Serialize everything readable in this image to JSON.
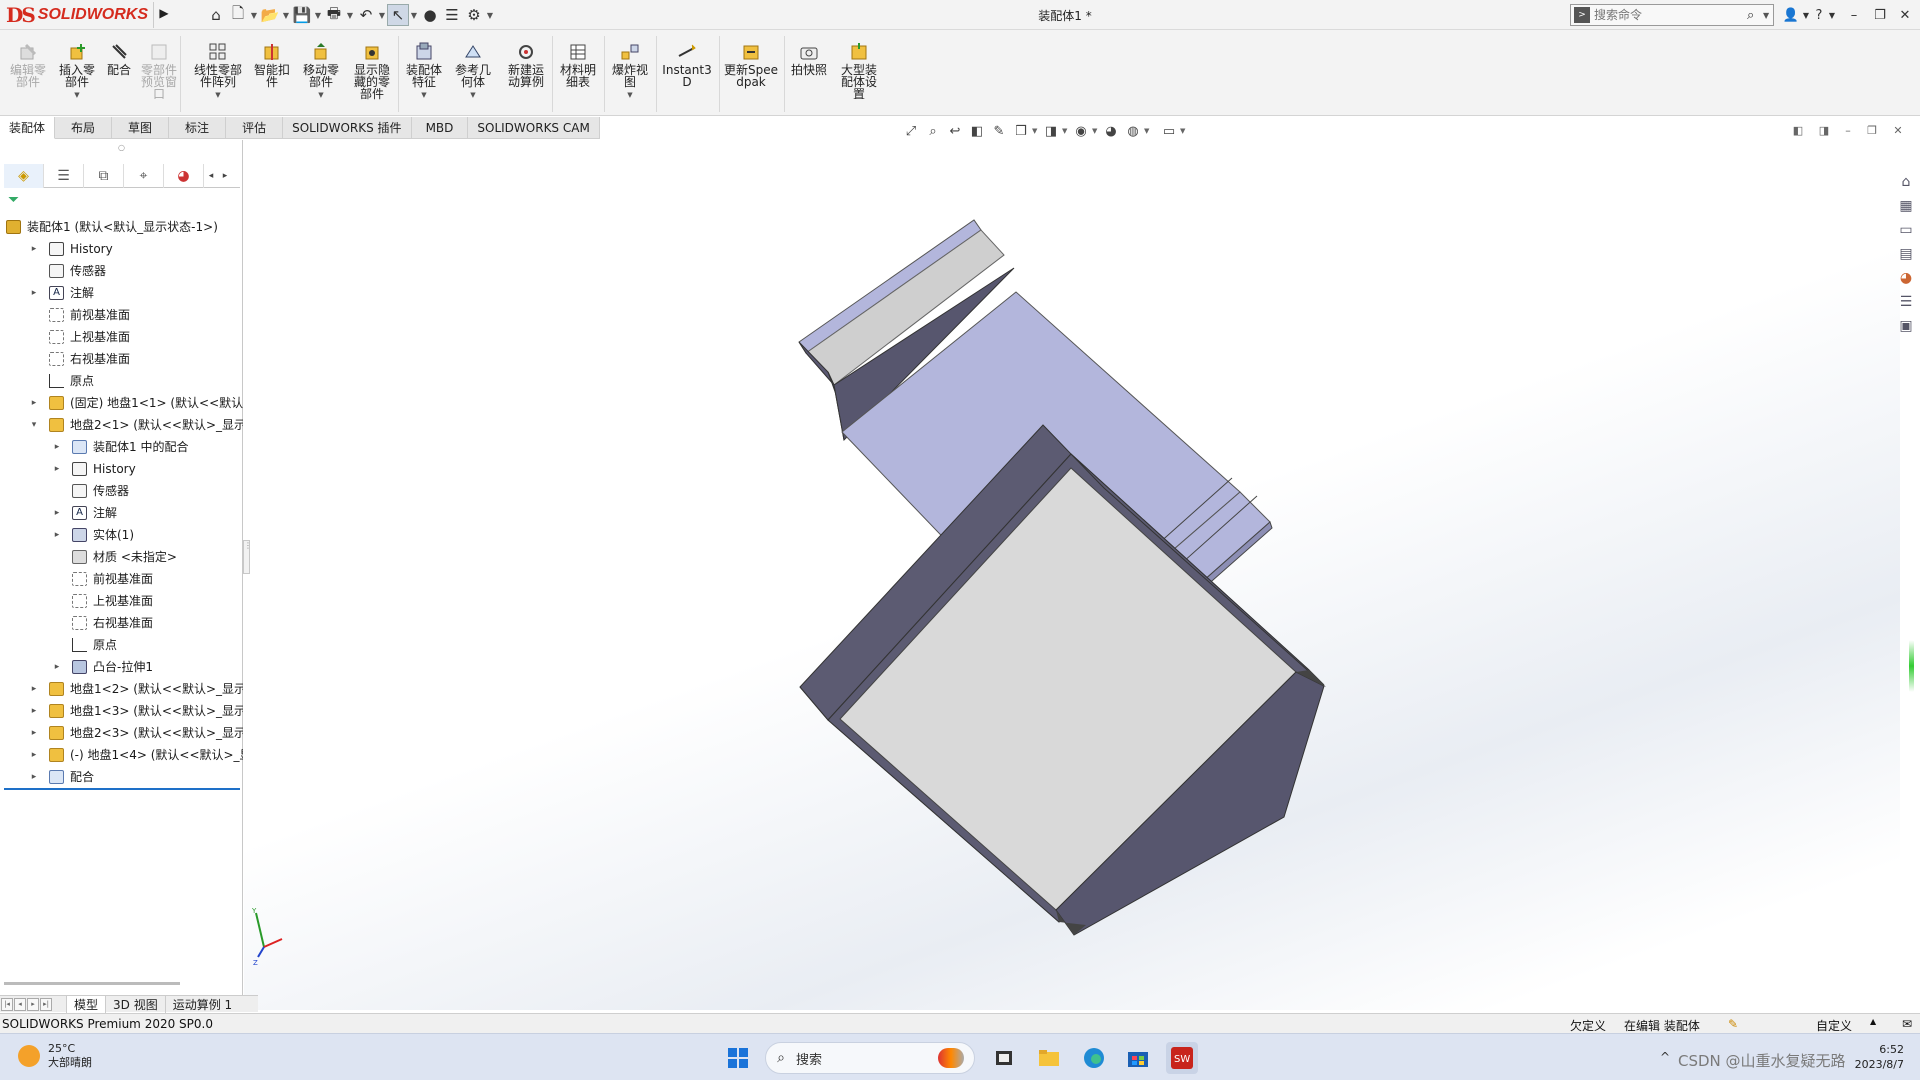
{
  "window": {
    "logo_mark": "DS",
    "logo_text": "SOLIDWORKS",
    "title": "装配体1 *",
    "search_placeholder": "搜索命令"
  },
  "quick_access": [
    "home-icon",
    "new-icon",
    "open-icon",
    "save-icon",
    "print-icon",
    "undo-icon",
    "select-icon",
    "rebuild-icon",
    "file-properties-icon",
    "options-icon"
  ],
  "toolbar": [
    {
      "label": "编辑零部件",
      "disabled": true,
      "icon": "edit-component-icon"
    },
    {
      "label": "插入零部件",
      "disabled": false,
      "icon": "insert-component-icon",
      "dropdown": true
    },
    {
      "label": "配合",
      "disabled": false,
      "icon": "mate-icon"
    },
    {
      "label": "零部件预览窗口",
      "disabled": true,
      "icon": "component-preview-icon"
    },
    {
      "label": "线性零部件阵列",
      "disabled": false,
      "icon": "linear-pattern-icon",
      "dropdown": true
    },
    {
      "label": "智能扣件",
      "disabled": false,
      "icon": "smart-fasteners-icon"
    },
    {
      "label": "移动零部件",
      "disabled": false,
      "icon": "move-component-icon",
      "dropdown": true
    },
    {
      "label": "显示隐藏的零部件",
      "disabled": false,
      "icon": "show-hidden-icon"
    },
    {
      "label": "装配体特征",
      "disabled": false,
      "icon": "assembly-features-icon",
      "dropdown": true
    },
    {
      "label": "参考几何体",
      "disabled": false,
      "icon": "reference-geometry-icon",
      "dropdown": true
    },
    {
      "label": "新建运动算例",
      "disabled": false,
      "icon": "new-motion-study-icon"
    },
    {
      "label": "材料明细表",
      "disabled": false,
      "icon": "bom-icon"
    },
    {
      "label": "爆炸视图",
      "disabled": false,
      "icon": "exploded-view-icon",
      "dropdown": true
    },
    {
      "label": "Instant3D",
      "disabled": false,
      "icon": "instant3d-icon"
    },
    {
      "label": "更新Speedpak",
      "disabled": false,
      "icon": "speedpak-icon"
    },
    {
      "label": "拍快照",
      "disabled": false,
      "icon": "snapshot-icon"
    },
    {
      "label": "大型装配体设置",
      "disabled": false,
      "icon": "large-assembly-icon"
    }
  ],
  "tabs": [
    "装配体",
    "布局",
    "草图",
    "标注",
    "评估",
    "SOLIDWORKS 插件",
    "MBD",
    "SOLIDWORKS CAM"
  ],
  "active_tab": "装配体",
  "tree": [
    {
      "label": "装配体1  (默认<默认_显示状态-1>)",
      "level": 0,
      "expander": "",
      "icon": "asm"
    },
    {
      "label": "History",
      "level": 1,
      "expander": "▸",
      "icon": "hist"
    },
    {
      "label": "传感器",
      "level": 1,
      "expander": "",
      "icon": "sens"
    },
    {
      "label": "注解",
      "level": 1,
      "expander": "▸",
      "icon": "ann"
    },
    {
      "label": "前视基准面",
      "level": 1,
      "expander": "",
      "icon": "plane"
    },
    {
      "label": "上视基准面",
      "level": 1,
      "expander": "",
      "icon": "plane"
    },
    {
      "label": "右视基准面",
      "level": 1,
      "expander": "",
      "icon": "plane"
    },
    {
      "label": "原点",
      "level": 1,
      "expander": "",
      "icon": "orig"
    },
    {
      "label": "(固定) 地盘1<1> (默认<<默认>_显",
      "level": 1,
      "expander": "▸",
      "icon": "part"
    },
    {
      "label": "地盘2<1> (默认<<默认>_显示状态",
      "level": 1,
      "expander": "▾",
      "icon": "part"
    },
    {
      "label": "装配体1 中的配合",
      "level": 2,
      "expander": "▸",
      "icon": "mate"
    },
    {
      "label": "History",
      "level": 2,
      "expander": "▸",
      "icon": "hist"
    },
    {
      "label": "传感器",
      "level": 2,
      "expander": "",
      "icon": "sens"
    },
    {
      "label": "注解",
      "level": 2,
      "expander": "▸",
      "icon": "ann"
    },
    {
      "label": "实体(1)",
      "level": 2,
      "expander": "▸",
      "icon": "body"
    },
    {
      "label": "材质 <未指定>",
      "level": 2,
      "expander": "",
      "icon": "mat"
    },
    {
      "label": "前视基准面",
      "level": 2,
      "expander": "",
      "icon": "plane"
    },
    {
      "label": "上视基准面",
      "level": 2,
      "expander": "",
      "icon": "plane"
    },
    {
      "label": "右视基准面",
      "level": 2,
      "expander": "",
      "icon": "plane"
    },
    {
      "label": "原点",
      "level": 2,
      "expander": "",
      "icon": "orig"
    },
    {
      "label": "凸台-拉伸1",
      "level": 2,
      "expander": "▸",
      "icon": "feat"
    },
    {
      "label": "地盘1<2> (默认<<默认>_显示状态",
      "level": 1,
      "expander": "▸",
      "icon": "part"
    },
    {
      "label": "地盘1<3> (默认<<默认>_显示状态",
      "level": 1,
      "expander": "▸",
      "icon": "part"
    },
    {
      "label": "地盘2<3> (默认<<默认>_显示状态",
      "level": 1,
      "expander": "▸",
      "icon": "part"
    },
    {
      "label": "(-) 地盘1<4> (默认<<默认>_显示",
      "level": 1,
      "expander": "▸",
      "icon": "part"
    },
    {
      "label": "配合",
      "level": 1,
      "expander": "▸",
      "icon": "mate"
    }
  ],
  "bottom_tabs": [
    "模型",
    "3D 视图",
    "运动算例 1"
  ],
  "active_bottom_tab": "模型",
  "status": {
    "product": "SOLIDWORKS Premium 2020 SP0.0",
    "underdefined": "欠定义",
    "editing": "在编辑 装配体",
    "custom": "自定义"
  },
  "taskbar": {
    "temperature": "25°C",
    "weather": "大部晴朗",
    "search_label": "搜索",
    "watermark": "CSDN @山重水复疑无路",
    "time": "6:52",
    "date": "2023/8/7"
  },
  "colors": {
    "brand_red": "#d52b1e",
    "accent_blue": "#1e70c8",
    "model_face_blue": "#b3b6dc",
    "model_face_grey": "#d9d9d9",
    "model_edge_dark": "#57566e"
  }
}
